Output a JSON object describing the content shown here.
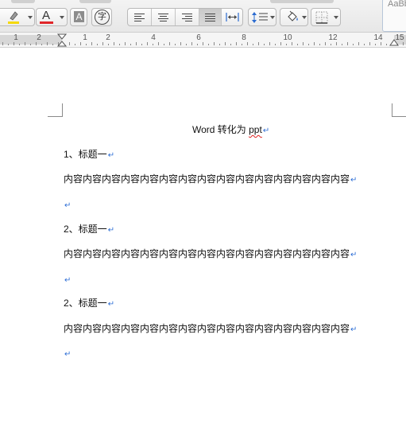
{
  "toolbar": {
    "font_color_glyph": "A",
    "char_shading_glyph": "A",
    "phonetic_glyph": "字",
    "highlight_color": "#f5d90a",
    "font_color": "#e0262a",
    "buttons": {
      "highlight": "highlighter-icon",
      "font_color": "font-color-icon",
      "char_shading": "character-shading-icon",
      "phonetic": "phonetic-guide-icon",
      "align_left": "align-left-icon",
      "align_center": "align-center-icon",
      "align_right": "align-right-icon",
      "justify": "justify-icon",
      "distributed": "distributed-icon",
      "line_spacing": "line-spacing-icon",
      "shading": "paint-bucket-icon",
      "borders": "borders-icon"
    },
    "active_alignment": "justify",
    "styles_preview": "AaBb"
  },
  "ruler": {
    "labels": [
      "2",
      "1",
      "1",
      "2",
      "4",
      "6",
      "8",
      "10",
      "12",
      "14",
      "15"
    ]
  },
  "document": {
    "title_main": "Word 转化为 ",
    "title_misspelled": "ppt",
    "paragraphs": [
      {
        "text": "1、标题一"
      },
      {
        "text": "内容内容内容内容内容内容内容内容内容内容内容内容内容内容内容"
      },
      {
        "text": ""
      },
      {
        "text": "2、标题一"
      },
      {
        "text": "内容内容内容内容内容内容内容内容内容内容内容内容内容内容内容"
      },
      {
        "text": ""
      },
      {
        "text": "2、标题一"
      },
      {
        "text": "内容内容内容内容内容内容内容内容内容内容内容内容内容内容内容"
      },
      {
        "text": ""
      }
    ],
    "paragraph_mark": "↵",
    "mark_color": "#2f6fd6"
  }
}
